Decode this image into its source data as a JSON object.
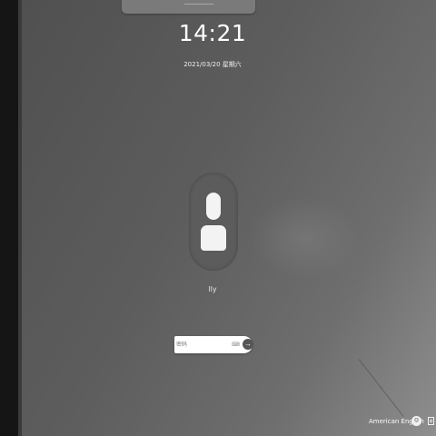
{
  "lock_screen": {
    "time": "14:21",
    "date": "2021/03/20 星期六",
    "user_name": "lly",
    "password_placeholder": "密码",
    "submit_glyph": "→",
    "keyboard_glyph": "⌨"
  },
  "tray": {
    "language_label": "American English",
    "user_switch_glyph": "☺"
  },
  "colors": {
    "background": "#5d5d5d",
    "left_strip": "#151515",
    "input_background": "#ffffff",
    "text": "#ffffff"
  },
  "icons": [
    "user-avatar-icon",
    "keyboard-icon",
    "arrow-right-icon",
    "user-switch-icon",
    "power-icon"
  ]
}
